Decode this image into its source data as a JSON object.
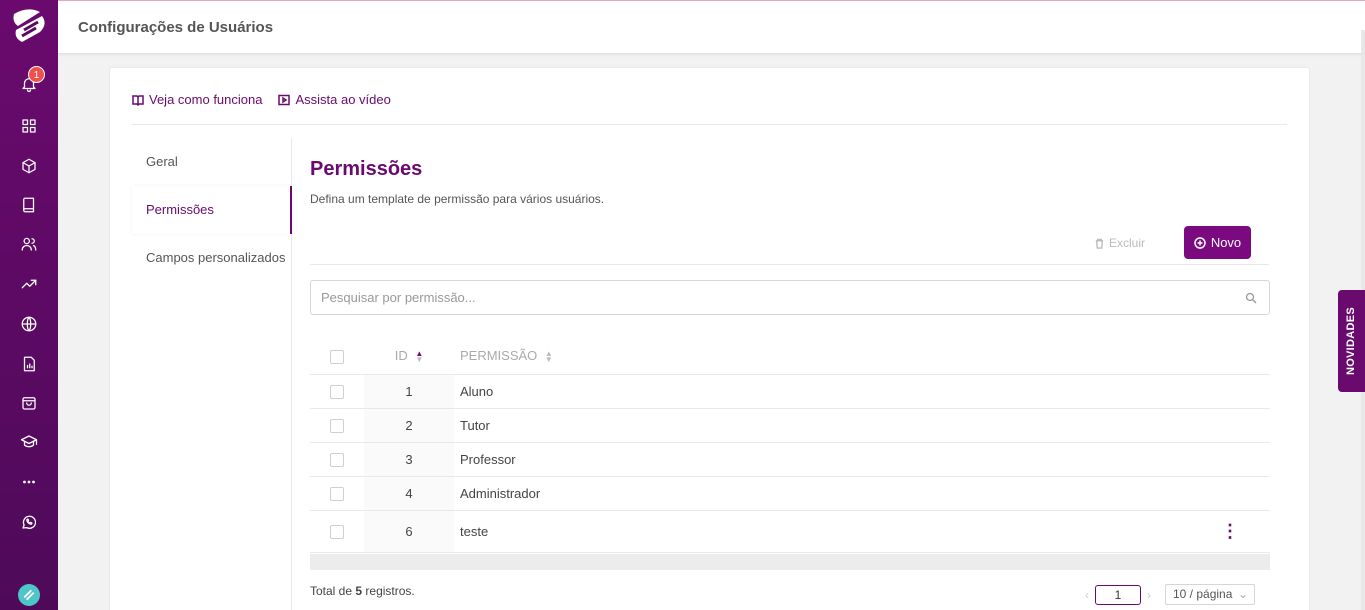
{
  "header": {
    "title": "Configurações de Usuários"
  },
  "sidebar": {
    "notification_count": "1",
    "icons": [
      "logo-icon",
      "bell-icon",
      "grid-icon",
      "cube-icon",
      "book-icon",
      "users-icon",
      "trending-icon",
      "globe-icon",
      "report-icon",
      "bag-icon",
      "graduation-icon",
      "more-icon",
      "whatsapp-icon"
    ]
  },
  "help": {
    "how_it_works": "Veja como funciona",
    "watch_video": "Assista ao vídeo"
  },
  "submenu": {
    "items": [
      {
        "label": "Geral"
      },
      {
        "label": "Permissões"
      },
      {
        "label": "Campos personalizados"
      }
    ]
  },
  "section": {
    "title": "Permissões",
    "description": "Defina um template de permissão para vários usuários."
  },
  "actions": {
    "delete_label": "Excluir",
    "new_label": "Novo"
  },
  "search": {
    "placeholder": "Pesquisar por permissão..."
  },
  "table": {
    "columns": {
      "id": "ID",
      "permission": "PERMISSÃO"
    },
    "rows": [
      {
        "id": "1",
        "name": "Aluno"
      },
      {
        "id": "2",
        "name": "Tutor"
      },
      {
        "id": "3",
        "name": "Professor"
      },
      {
        "id": "4",
        "name": "Administrador"
      },
      {
        "id": "6",
        "name": "teste"
      }
    ]
  },
  "footer": {
    "total_prefix": "Total de ",
    "total_count": "5",
    "total_suffix": " registros.",
    "current_page": "1",
    "page_size": "10 / página"
  },
  "novidades_tab": "NOVIDADES",
  "colors": {
    "primary": "#6a0a6e",
    "button": "#7b0a80",
    "badge": "#f0504b"
  }
}
